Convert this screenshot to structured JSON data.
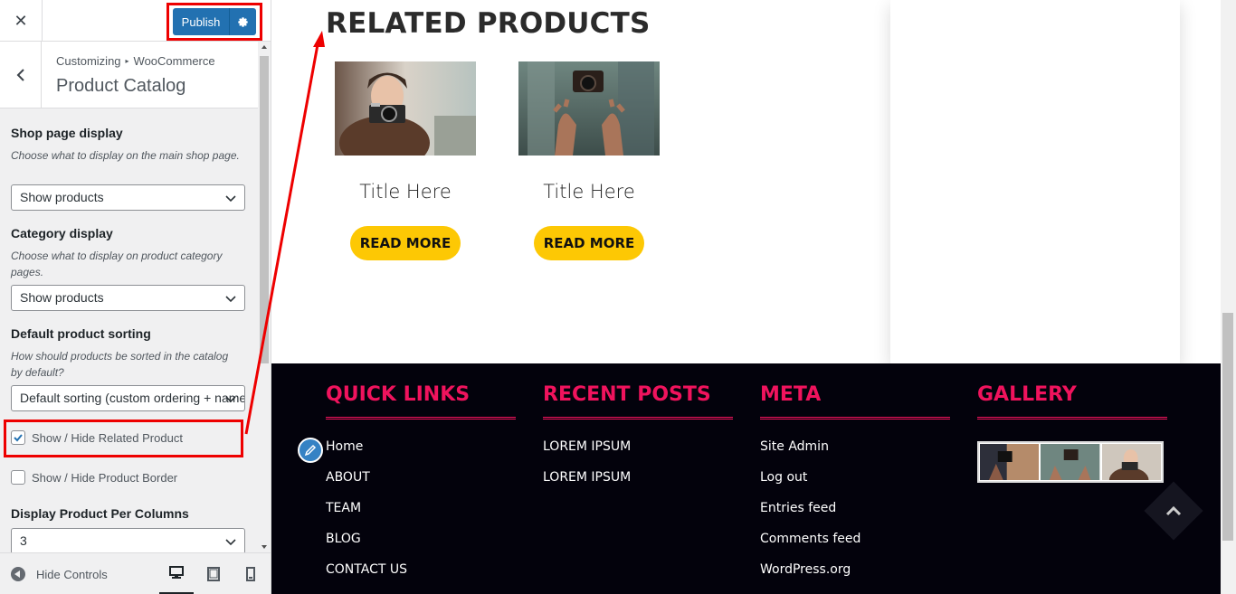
{
  "header": {
    "close_glyph": "✕",
    "publish_label": "Publish",
    "settings_icon": "gear-icon"
  },
  "panel": {
    "breadcrumb_root": "Customizing",
    "breadcrumb_sep": "▸",
    "breadcrumb_section": "WooCommerce",
    "title": "Product Catalog"
  },
  "controls": {
    "shop_display": {
      "title": "Shop page display",
      "desc": "Choose what to display on the main shop page.",
      "value": "Show products"
    },
    "category_display": {
      "title": "Category display",
      "desc": "Choose what to display on product category pages.",
      "value": "Show products"
    },
    "sorting": {
      "title": "Default product sorting",
      "desc": "How should products be sorted in the catalog by default?",
      "value": "Default sorting (custom ordering + name)"
    },
    "related_toggle": {
      "label": "Show / Hide Related Product",
      "checked": true
    },
    "border_toggle": {
      "label": "Show / Hide Product Border",
      "checked": false
    },
    "columns": {
      "title": "Display Product Per Columns",
      "value": "3"
    }
  },
  "footer_bar": {
    "hide_controls": "Hide Controls",
    "devices": [
      "desktop-icon",
      "tablet-icon",
      "mobile-icon"
    ],
    "active_device": "desktop"
  },
  "preview": {
    "related_title": "RELATED PRODUCTS",
    "products": [
      {
        "title": "Title Here",
        "button": "READ MORE"
      },
      {
        "title": "Title Here",
        "button": "READ MORE"
      }
    ],
    "footer": {
      "columns": [
        {
          "heading": "QUICK LINKS",
          "links": [
            "Home",
            "ABOUT",
            "TEAM",
            "BLOG",
            "CONTACT US"
          ]
        },
        {
          "heading": "RECENT POSTS",
          "links": [
            "LOREM IPSUM",
            "LOREM IPSUM"
          ]
        },
        {
          "heading": "META",
          "links": [
            "Site Admin",
            "Log out",
            "Entries feed",
            "Comments feed",
            "WordPress.org"
          ]
        },
        {
          "heading": "GALLERY",
          "links": []
        }
      ]
    }
  },
  "colors": {
    "publish_blue": "#2271b1",
    "highlight_red": "#e00000",
    "read_more_yellow": "#fdc804",
    "footer_heading_pink": "#f0135d",
    "footer_bg": "#03020c"
  }
}
